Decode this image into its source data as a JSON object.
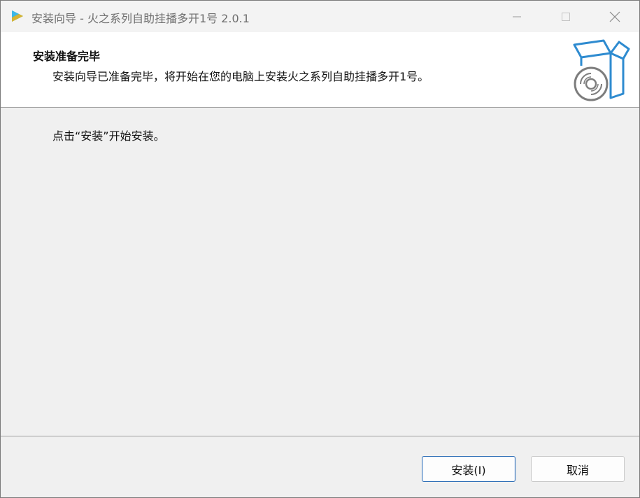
{
  "window": {
    "title": "安装向导 - 火之系列自助挂播多开1号 2.0.1"
  },
  "header": {
    "title": "安装准备完毕",
    "subtitle": "安装向导已准备完毕，将开始在您的电脑上安装火之系列自助挂播多开1号。"
  },
  "content": {
    "message": "点击“安装”开始安装。"
  },
  "buttons": {
    "install_label": "安装(I)",
    "cancel_label": "取消"
  },
  "colors": {
    "accent": "#2f6fb6",
    "graphic_blue": "#2e8bd0",
    "disc_gray": "#7d7d7d"
  },
  "icons": {
    "app": "app-logo-icon",
    "header_graphic": "install-box-disc-icon"
  }
}
